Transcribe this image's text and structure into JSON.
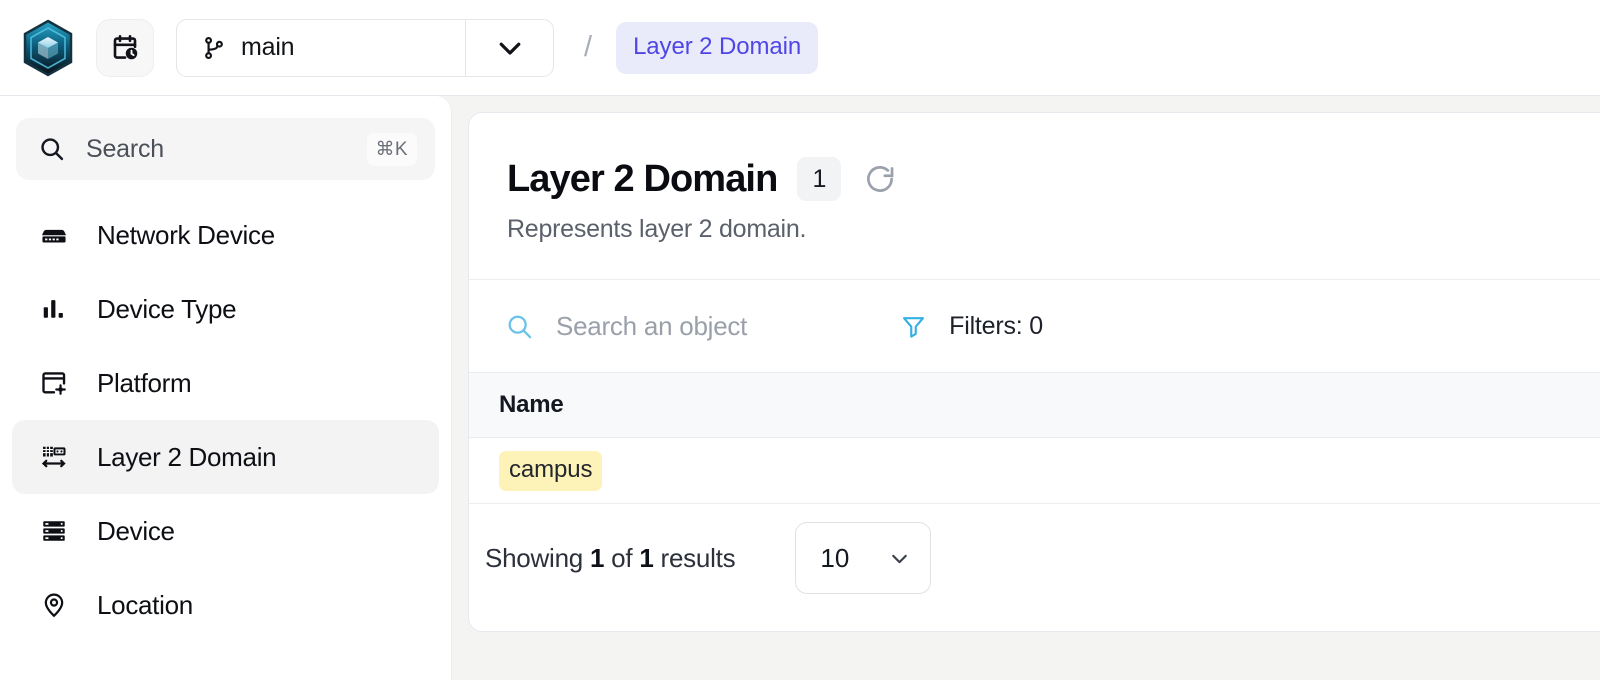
{
  "header": {
    "logo_icon": "infrahub-cube-logo",
    "history_button": {
      "icon": "calendar-clock-icon",
      "label": ""
    },
    "branch_selector": {
      "icon": "git-branch-icon",
      "value": "main",
      "caret_icon": "chevron-down-icon"
    },
    "breadcrumb": {
      "separator": "/",
      "current": "Layer 2 Domain"
    }
  },
  "sidebar": {
    "search": {
      "icon": "search-icon",
      "placeholder": "Search",
      "shortcut": "⌘K"
    },
    "items": [
      {
        "label": "Network Device",
        "icon": "network-switch-icon",
        "active": false
      },
      {
        "label": "Device Type",
        "icon": "bar-chart-icon",
        "active": false
      },
      {
        "label": "Platform",
        "icon": "window-gear-icon",
        "active": false
      },
      {
        "label": "Layer 2 Domain",
        "icon": "layer2-topology-icon",
        "active": true
      },
      {
        "label": "Device",
        "icon": "server-rack-icon",
        "active": false
      },
      {
        "label": "Location",
        "icon": "map-pin-icon",
        "active": false
      }
    ]
  },
  "main": {
    "title": "Layer 2 Domain",
    "count": "1",
    "refresh_icon": "refresh-icon",
    "subtitle": "Represents layer 2 domain.",
    "toolbar": {
      "search_icon": "search-icon",
      "search_placeholder": "Search an object",
      "filter_icon": "filter-icon",
      "filters_label": "Filters: 0"
    },
    "table": {
      "columns": [
        "Name"
      ],
      "rows": [
        {
          "name": "campus"
        }
      ]
    },
    "footer": {
      "showing_prefix": "Showing",
      "showing_count": "1",
      "showing_middle": "of",
      "showing_total": "1",
      "showing_suffix": "results",
      "page_size": "10",
      "page_size_caret": "chevron-down-icon"
    }
  },
  "colors": {
    "accent": "#4f46e5",
    "accent_bg": "#e9ebfb",
    "icon_blue": "#4fb3e0",
    "tag_yellow": "#fdf2b8",
    "page_bg": "#f4f4f2"
  }
}
